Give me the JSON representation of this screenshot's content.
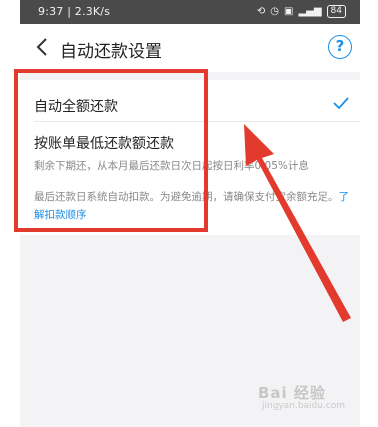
{
  "status_bar": {
    "time_speed": "9:37 | 2.3K/s",
    "icons": [
      "sync-icon",
      "alarm-icon",
      "sim-icon",
      "signal-icon"
    ],
    "battery": "84"
  },
  "nav": {
    "back_icon": "chevron-left-icon",
    "title": "自动还款设置",
    "help_icon": "question-circle-icon",
    "help_symbol": "?"
  },
  "options": {
    "full_repayment": "自动全额还款",
    "full_repayment_selected": true,
    "min_repayment": "按账单最低还款额还款",
    "min_repayment_desc": "剩余下期还，从本月最后还款日次日起按日利率0.05%计息"
  },
  "notice": {
    "text": "最后还款日系统自动扣款。为避免逾期，请确保支付宝余额充足。",
    "link": "了解扣款顺序"
  },
  "watermark": {
    "text": "Bai 经验",
    "sub": "jingyan.baidu.com"
  },
  "colors": {
    "accent": "#1b8fe8",
    "annotation_red": "#e23a2c",
    "status_bar": "#4a4a4a"
  }
}
